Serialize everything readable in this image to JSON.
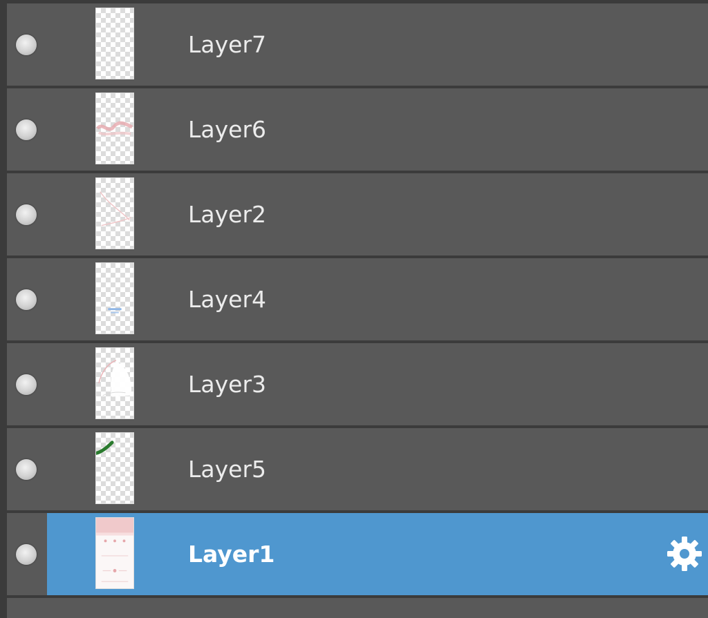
{
  "layers_panel": {
    "selected_layer": "Layer1",
    "layers": [
      {
        "label": "Layer7",
        "visible": true,
        "selected": false
      },
      {
        "label": "Layer6",
        "visible": true,
        "selected": false
      },
      {
        "label": "Layer2",
        "visible": true,
        "selected": false
      },
      {
        "label": "Layer4",
        "visible": true,
        "selected": false
      },
      {
        "label": "Layer3",
        "visible": true,
        "selected": false
      },
      {
        "label": "Layer5",
        "visible": true,
        "selected": false
      },
      {
        "label": "Layer1",
        "visible": true,
        "selected": true
      }
    ],
    "icons": {
      "visibility": "visibility-dot-icon",
      "settings": "gear-icon"
    },
    "colors": {
      "panel_background": "#3b3b3b",
      "row_background": "#595959",
      "selected_background": "#4f97cf",
      "text": "#ececec",
      "selected_text": "#ffffff"
    }
  }
}
